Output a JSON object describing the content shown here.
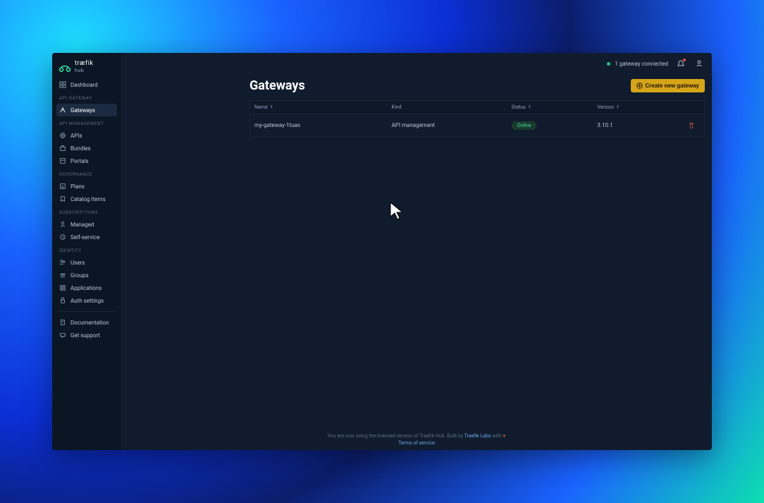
{
  "brand": {
    "name": "træfik",
    "sub": "hub"
  },
  "sidebar": {
    "items": [
      {
        "label": "Dashboard"
      }
    ],
    "sections": [
      {
        "title": "API GATEWAY",
        "items": [
          {
            "label": "Gateways",
            "active": true
          }
        ]
      },
      {
        "title": "API MANAGEMENT",
        "items": [
          {
            "label": "APIs"
          },
          {
            "label": "Bundles"
          },
          {
            "label": "Portals"
          }
        ]
      },
      {
        "title": "GOVERNANCE",
        "items": [
          {
            "label": "Plans"
          },
          {
            "label": "Catalog Items"
          }
        ]
      },
      {
        "title": "SUBSCRIPTIONS",
        "items": [
          {
            "label": "Managed"
          },
          {
            "label": "Self-service"
          }
        ]
      },
      {
        "title": "IDENTITY",
        "items": [
          {
            "label": "Users"
          },
          {
            "label": "Groups"
          },
          {
            "label": "Applications"
          },
          {
            "label": "Auth settings"
          }
        ]
      }
    ],
    "footer": [
      {
        "label": "Documentation"
      },
      {
        "label": "Get support"
      }
    ]
  },
  "topbar": {
    "status_text": "1 gateway connected"
  },
  "page": {
    "title": "Gateways",
    "create_label": "Create new gateway"
  },
  "table": {
    "columns": {
      "name": "Name",
      "kind": "Kind",
      "status": "Status",
      "version": "Version"
    },
    "rows": [
      {
        "name": "my-gateway-1tuas",
        "kind": "API management",
        "status": "Online",
        "version": "3.10.1"
      }
    ]
  },
  "footer": {
    "line1_prefix": "You are now using the licensed version of Traefik Hub. Built by ",
    "link_text": "Traefik Labs",
    "line1_suffix": " with ",
    "tos": "Terms of service"
  }
}
